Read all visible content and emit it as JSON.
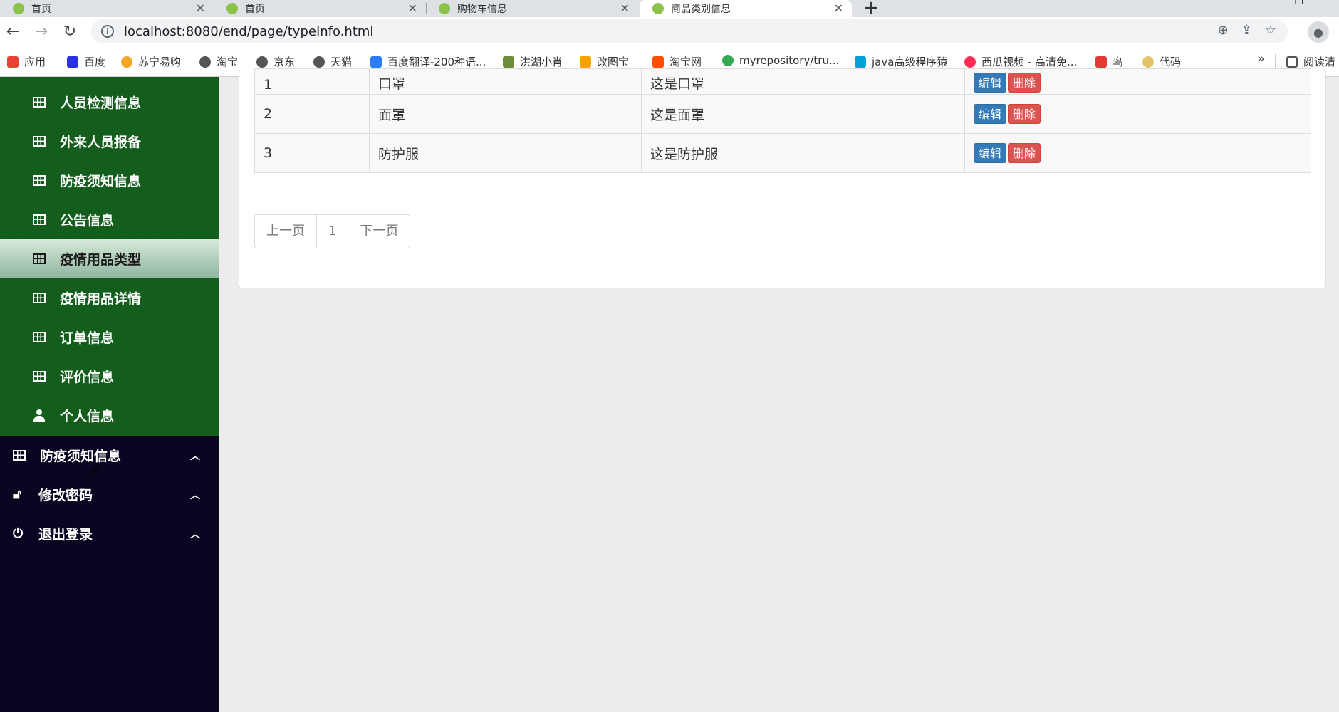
{
  "browser": {
    "tabs": [
      {
        "title": "首页"
      },
      {
        "title": "首页"
      },
      {
        "title": "购物车信息"
      },
      {
        "title": "商品类别信息"
      }
    ],
    "url": "localhost:8080/end/page/typeInfo.html",
    "bookmarks": [
      {
        "label": "应用",
        "icon": "apps-grid-icon",
        "color": "#e94235"
      },
      {
        "label": "百度",
        "icon": "baidu-paw-icon",
        "color": "#2932e1"
      },
      {
        "label": "苏宁易购",
        "icon": "suning-icon",
        "color": "#f5a623"
      },
      {
        "label": "淘宝",
        "icon": "globe-icon",
        "color": "#555555"
      },
      {
        "label": "京东",
        "icon": "globe-icon",
        "color": "#555555"
      },
      {
        "label": "天猫",
        "icon": "globe-icon",
        "color": "#555555"
      },
      {
        "label": "百度翻译-200种语...",
        "icon": "translate-icon",
        "color": "#2f7df6"
      },
      {
        "label": "洪湖小肖",
        "icon": "bird-icon",
        "color": "#6d8c3a"
      },
      {
        "label": "改图宝",
        "icon": "image-edit-icon",
        "color": "#f7a200"
      },
      {
        "label": "淘宝网",
        "icon": "taobao-icon",
        "color": "#ff5000"
      },
      {
        "label": "myrepository/tru...",
        "icon": "chrome-icon",
        "color": "#34a853"
      },
      {
        "label": "java高级程序猿",
        "icon": "bilibili-icon",
        "color": "#00a1d6"
      },
      {
        "label": "西瓜视频 - 高清免...",
        "icon": "xigua-icon",
        "color": "#fe2c55"
      },
      {
        "label": "鸟",
        "icon": "bird-red-icon",
        "color": "#e53935"
      },
      {
        "label": "代码",
        "icon": "moon-icon",
        "color": "#e0c36b"
      }
    ],
    "reading_list": "阅读清"
  },
  "sidebar": {
    "submenu_items": [
      {
        "label": "人员检测信息",
        "icon": "table-icon"
      },
      {
        "label": "外来人员报备",
        "icon": "table-icon"
      },
      {
        "label": "防疫须知信息",
        "icon": "table-icon"
      },
      {
        "label": "公告信息",
        "icon": "table-icon"
      },
      {
        "label": "疫情用品类型",
        "icon": "table-icon",
        "active": true
      },
      {
        "label": "疫情用品详情",
        "icon": "table-icon"
      },
      {
        "label": "订单信息",
        "icon": "table-icon"
      },
      {
        "label": "评价信息",
        "icon": "table-icon"
      },
      {
        "label": "个人信息",
        "icon": "user-icon"
      }
    ],
    "menu_items": [
      {
        "label": "防疫须知信息",
        "icon": "table-icon"
      },
      {
        "label": "修改密码",
        "icon": "lock-icon"
      },
      {
        "label": "退出登录",
        "icon": "power-icon"
      }
    ]
  },
  "table": {
    "rows": [
      {
        "id": "1",
        "name": "口罩",
        "desc": "这是口罩"
      },
      {
        "id": "2",
        "name": "面罩",
        "desc": "这是面罩"
      },
      {
        "id": "3",
        "name": "防护服",
        "desc": "这是防护服"
      }
    ],
    "edit_label": "编辑",
    "delete_label": "删除"
  },
  "pagination": {
    "prev": "上一页",
    "page": "1",
    "next": "下一页"
  },
  "colors": {
    "sidebar_green": "#135e1c",
    "sidebar_dark": "#0a0520",
    "edit_blue": "#337ab7",
    "delete_red": "#d9534f"
  }
}
